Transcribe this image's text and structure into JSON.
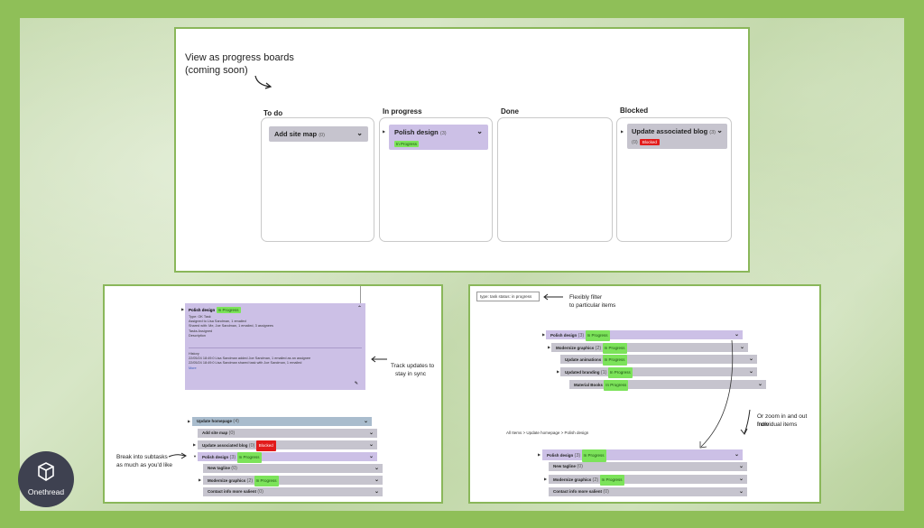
{
  "top_panel": {
    "note_line1": "View as progress boards",
    "note_line2": "(coming soon)",
    "columns": [
      {
        "title": "To do"
      },
      {
        "title": "In progress"
      },
      {
        "title": "Done"
      },
      {
        "title": "Blocked"
      }
    ],
    "todo_card": {
      "label": "Add site map",
      "count": "(0)"
    },
    "inprogress_card": {
      "label": "Polish design",
      "count": "(3)",
      "badge": "In Progress"
    },
    "blocked_card": {
      "label": "Update associated blog",
      "count": "(3)",
      "count2": "(0)",
      "badge": "Blocked"
    }
  },
  "left_panel": {
    "detail": {
      "title": "Polish design",
      "meta": [
        "Type: OK Task",
        "Assigned to Lisa Sandman, 1 emailed",
        "Shared with: Me, Joe Sandman, 1 emailed, 3 assignees",
        "Tasks Assigned",
        "Description"
      ],
      "history_label": "History",
      "history": [
        "22/05/24 18:49:0 Lisa Sandman added Joe Sandman, 1 emailed as an assignee",
        "22/05/24 18:49:0 Lisa Sandman shared task with Joe Sandman, 1 emailed",
        "More"
      ],
      "badge": "In Progress"
    },
    "note_track_line1": "Track updates to",
    "note_track_line2": "stay in sync",
    "note_break_line1": "Break into subtasks",
    "note_break_line2": "as much as you'd like",
    "rows": [
      {
        "label": "Update homepage",
        "count": "(4)",
        "badge": ""
      },
      {
        "label": "Add site map",
        "count": "(0)",
        "badge": ""
      },
      {
        "label": "Update associated blog",
        "count": "(0)",
        "badge": "Blocked"
      },
      {
        "label": "Polish design",
        "count": "(3)",
        "badge": "In Progress"
      },
      {
        "label": "New tagline",
        "count": "(0)",
        "badge": ""
      },
      {
        "label": "Modernize graphics",
        "count": "(2)",
        "badge": "In Progress"
      },
      {
        "label": "Contact info more salient",
        "count": "(0)",
        "badge": ""
      }
    ]
  },
  "right_panel": {
    "filter_value": "type: task status: in progress",
    "note_filter_line1": "Flexibly filter",
    "note_filter_line2": "to particular items",
    "note_zoom_line1": "Or zoom in and out from",
    "note_zoom_line2": "individual items",
    "breadcrumb": "All Items > Update homepage > Polish design",
    "tree_rows": [
      {
        "label": "Polish design",
        "count": "(3)",
        "badge": "In Progress"
      },
      {
        "label": "Modernize graphics",
        "count": "(2)",
        "badge": "In Progress"
      },
      {
        "label": "Update animations",
        "count": "",
        "badge": "In Progress"
      },
      {
        "label": "Updated branding",
        "count": "(1)",
        "badge": "In Progress"
      },
      {
        "label": "Material Books",
        "count": "",
        "badge": "In Progress"
      }
    ],
    "zoom_rows": [
      {
        "label": "Polish design",
        "count": "(3)",
        "badge": "In Progress"
      },
      {
        "label": "New tagline",
        "count": "(0)",
        "badge": ""
      },
      {
        "label": "Modernize graphics",
        "count": "(2)",
        "badge": "In Progress"
      },
      {
        "label": "Contact info more salient",
        "count": "(0)",
        "badge": ""
      }
    ]
  },
  "brand": {
    "name": "Onethread"
  },
  "colors": {
    "frame": "#8fbf58",
    "lavender": "#ccc0e6",
    "gray": "#c6c4ce",
    "blue": "#a9bccd",
    "green_badge": "#7ce35a",
    "red_badge": "#e21b1b"
  }
}
